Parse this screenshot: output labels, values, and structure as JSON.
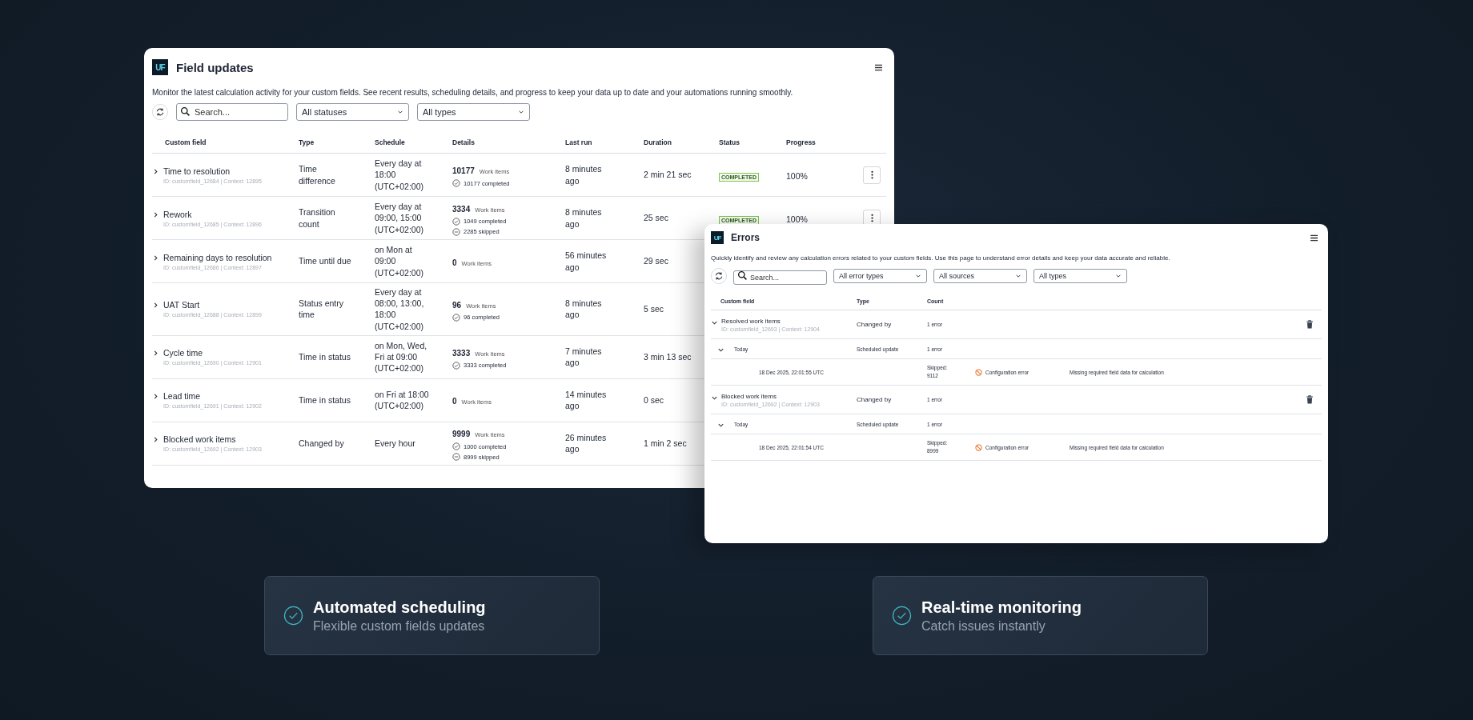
{
  "field_updates": {
    "logo": "UF",
    "title": "Field updates",
    "description": "Monitor the latest calculation activity for your custom fields. See recent results, scheduling details, and progress to keep your data up to date and your automations running smoothly.",
    "search": {
      "placeholder": "Search..."
    },
    "filters": [
      "All statuses",
      "All types"
    ],
    "columns": [
      "Custom field",
      "Type",
      "Schedule",
      "Details",
      "Last run",
      "Duration",
      "Status",
      "Progress"
    ],
    "rows": [
      {
        "name": "Time to resolution",
        "id_line": "ID: customfield_12684 | Context: 12895",
        "expanded": false,
        "type": "Time difference",
        "schedule": "Every day at 18:00 (UTC+02:00)",
        "total": "10177",
        "total_label": "Work items",
        "lines": [
          {
            "kind": "completed",
            "text": "10177 completed"
          }
        ],
        "last_run": "8 minutes ago",
        "duration": "2 min 21 sec",
        "status": "COMPLETED",
        "progress": "100%"
      },
      {
        "name": "Rework",
        "id_line": "ID: customfield_12685 | Context: 12896",
        "expanded": false,
        "type": "Transition count",
        "schedule": "Every day at 09:00, 15:00 (UTC+02:00)",
        "total": "3334",
        "total_label": "Work items",
        "lines": [
          {
            "kind": "completed",
            "text": "1049 completed"
          },
          {
            "kind": "skipped",
            "text": "2285 skipped"
          }
        ],
        "last_run": "8 minutes ago",
        "duration": "25 sec",
        "status": "COMPLETED",
        "progress": "100%"
      },
      {
        "name": "Remaining days to resolution",
        "id_line": "ID: customfield_12686 | Context: 12897",
        "expanded": false,
        "type": "Time until due",
        "schedule": "on Mon at 09:00 (UTC+02:00)",
        "total": "0",
        "total_label": "Work items",
        "lines": [],
        "last_run": "56 minutes ago",
        "duration": "29 sec"
      },
      {
        "name": "UAT Start",
        "id_line": "ID: customfield_12688 | Context: 12899",
        "expanded": false,
        "type": "Status entry time",
        "schedule": "Every day at 08:00, 13:00, 18:00 (UTC+02:00)",
        "total": "96",
        "total_label": "Work items",
        "lines": [
          {
            "kind": "completed",
            "text": "96 completed"
          }
        ],
        "last_run": "8 minutes ago",
        "duration": "5 sec"
      },
      {
        "name": "Cycle time",
        "id_line": "ID: customfield_12690 | Context: 12901",
        "expanded": false,
        "type": "Time in status",
        "schedule": "on Mon, Wed, Fri at 09:00 (UTC+02:00)",
        "total": "3333",
        "total_label": "Work items",
        "lines": [
          {
            "kind": "completed",
            "text": "3333 completed"
          }
        ],
        "last_run": "7 minutes ago",
        "duration": "3 min 13 sec"
      },
      {
        "name": "Lead time",
        "id_line": "ID: customfield_12691 | Context: 12902",
        "expanded": false,
        "type": "Time in status",
        "schedule": "on Fri at 18:00 (UTC+02:00)",
        "total": "0",
        "total_label": "Work items",
        "lines": [],
        "last_run": "14 minutes ago",
        "duration": "0 sec"
      },
      {
        "name": "Blocked work items",
        "id_line": "ID: customfield_12692 | Context: 12903",
        "expanded": false,
        "type": "Changed by",
        "schedule": "Every hour",
        "total": "9999",
        "total_label": "Work items",
        "lines": [
          {
            "kind": "completed",
            "text": "1000 completed"
          },
          {
            "kind": "skipped",
            "text": "8999 skipped"
          }
        ],
        "last_run": "26 minutes ago",
        "duration": "1 min 2 sec"
      }
    ]
  },
  "errors": {
    "logo": "UF",
    "title": "Errors",
    "description": "Quickly identify and review any calculation errors related to your custom fields. Use this page to understand error details and keep your data accurate and reliable.",
    "search": {
      "placeholder": "Search..."
    },
    "filters": [
      "All error types",
      "All sources",
      "All types"
    ],
    "columns": [
      "Custom field",
      "Type",
      "Count"
    ],
    "groups": [
      {
        "name": "Resolved work items",
        "id_line": "ID: customfield_12693 | Context: 12904",
        "expanded": true,
        "type": "Changed by",
        "count": "1 error",
        "children": [
          {
            "label": "Today",
            "expanded": true,
            "type": "Scheduled update",
            "count": "1 error",
            "entries": [
              {
                "time": "18 Dec 2025, 22:01:55 UTC",
                "skipped": "Skipped: 9112",
                "error": "Configuration error",
                "message": "Missing required field data for calculation"
              }
            ]
          }
        ]
      },
      {
        "name": "Blocked work items",
        "id_line": "ID: customfield_12692 | Context: 12903",
        "expanded": true,
        "type": "Changed by",
        "count": "1 error",
        "children": [
          {
            "label": "Today",
            "expanded": true,
            "type": "Scheduled update",
            "count": "1 error",
            "entries": [
              {
                "time": "18 Dec 2025, 22:01:54 UTC",
                "skipped": "Skipped: 8999",
                "error": "Configuration error",
                "message": "Missing required field data for calculation"
              }
            ]
          }
        ]
      }
    ]
  },
  "features": [
    {
      "title": "Automated scheduling",
      "subtitle": "Flexible custom fields updates"
    },
    {
      "title": "Real-time monitoring",
      "subtitle": "Catch issues instantly"
    }
  ]
}
